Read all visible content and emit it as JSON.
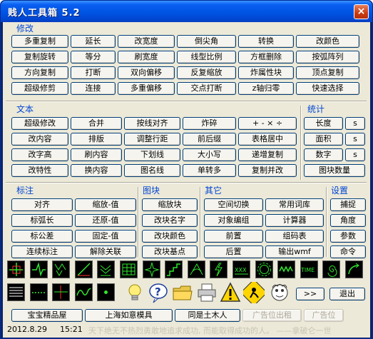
{
  "window": {
    "title": "贱人工具箱 5.2",
    "close_glyph": "×"
  },
  "groups": {
    "modify": "修改",
    "text": "文本",
    "stats": "统计",
    "dim": "标注",
    "block": "图块",
    "other": "其它",
    "settings": "设置"
  },
  "modify_buttons": [
    [
      "多重复制",
      "延长",
      "改宽度",
      "倒尖角",
      "转换",
      "改颜色"
    ],
    [
      "复制旋转",
      "等分",
      "刷宽度",
      "线型比例",
      "方框删除",
      "按弧阵列"
    ],
    [
      "方向复制",
      "打断",
      "双向偏移",
      "反复缩放",
      "炸属性块",
      "顶点复制"
    ],
    [
      "超级修剪",
      "连接",
      "多重偏移",
      "交点打断",
      "z轴归零",
      "快速选择"
    ]
  ],
  "text_buttons": [
    [
      "超级修改",
      "合并",
      "按线对齐",
      "炸碎",
      "+ - × ÷"
    ],
    [
      "改内容",
      "排版",
      "调整行距",
      "前后缀",
      "表格居中"
    ],
    [
      "改字高",
      "刷内容",
      "下划线",
      "大小写",
      "递增复制"
    ],
    [
      "改特性",
      "换内容",
      "图名线",
      "单转多",
      "复制并改"
    ]
  ],
  "stats_buttons": [
    [
      "长度",
      "s"
    ],
    [
      "面积",
      "s"
    ],
    [
      "数字",
      "s"
    ],
    [
      "图块数量"
    ]
  ],
  "dim_buttons": [
    [
      "对齐",
      "缩放-值"
    ],
    [
      "标弧长",
      "还原-值"
    ],
    [
      "标公差",
      "固定-值"
    ],
    [
      "连续标注",
      "解除关联"
    ]
  ],
  "block_buttons": [
    "缩放块",
    "改块名字",
    "改块颜色",
    "改块基点"
  ],
  "other_buttons": [
    [
      "空间切换",
      "常用词库"
    ],
    [
      "对象编组",
      "计算器"
    ],
    [
      "前置",
      "组码表"
    ],
    [
      "后置",
      "输出wmf"
    ]
  ],
  "settings_buttons": [
    "捕捉",
    "角度",
    "参数",
    "命令"
  ],
  "icon_row1": [
    "crosshair-icon",
    "zigzag-icon",
    "arrows-down-icon",
    "diagonal-icon",
    "stack-arrows-icon",
    "grid-table-icon",
    "spark-icon",
    "stairs-icon",
    "triangle-arc-icon",
    "lightning-icon",
    "xxx-text-icon",
    "gear-outline-icon",
    "wave-icon",
    "time-text-icon",
    "spiral-icon",
    "curve-arrow-icon"
  ],
  "icon_row1_text": {
    "xxx": "XXX",
    "time": "TIME"
  },
  "icon_row2": [
    "hatch-lines-icon",
    "dotted-line-icon",
    "cross-lines-icon",
    "squiggle-icon",
    "dot-icon"
  ],
  "big_icons": [
    "lightbulb-icon",
    "help-icon",
    "folder-icon",
    "printer-icon",
    "warning-icon",
    "worker-icon",
    "face-icon"
  ],
  "nav": {
    "next": ">>",
    "exit": "退出"
  },
  "links": [
    "宝宝精品屋",
    "上海如意模具",
    "同是土木人",
    "广告位出租",
    "广告位"
  ],
  "status": {
    "date": "2012.8.29",
    "time": "15:21",
    "message": "天下绝无不热烈勇敢地追求成功, 而能取得成功的人。 ——拿破仑一世"
  }
}
